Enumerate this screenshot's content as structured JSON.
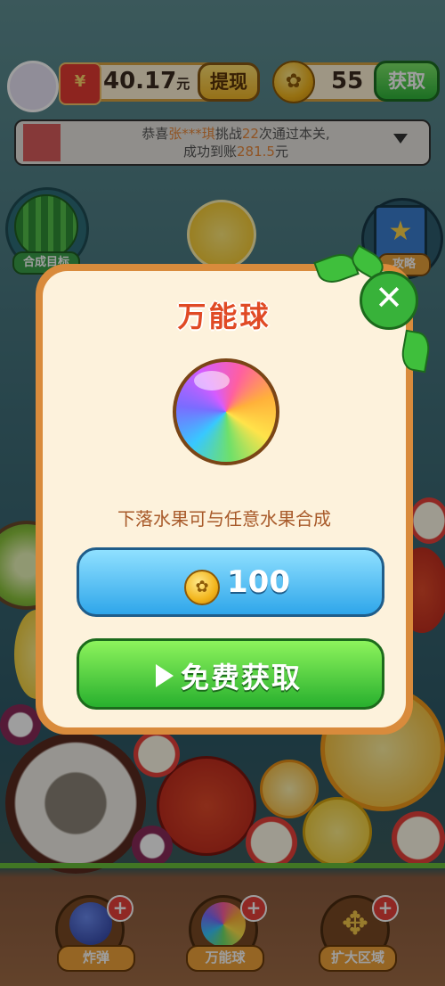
{
  "header": {
    "balance": "40.17",
    "balance_unit": "元",
    "redpack_symbol": "¥",
    "withdraw_label": "提现",
    "coins": "55",
    "get_label": "获取"
  },
  "notice": {
    "prefix": "恭喜",
    "name": "张***琪",
    "mid1": "挑战",
    "count": "22",
    "mid2": "次通过本关,",
    "line2_prefix": "成功到账",
    "amount": "281.5",
    "unit": "元"
  },
  "side": {
    "target_label": "合成目标",
    "guide_label": "攻略"
  },
  "modal": {
    "title": "万能球",
    "description": "下落水果可与任意水果合成",
    "price": "100",
    "free_label": "免费获取",
    "close_symbol": "✕"
  },
  "toolbar": {
    "items": [
      {
        "label": "炸弹",
        "icon": "bomb-icon"
      },
      {
        "label": "万能球",
        "icon": "rainbow-ball-icon"
      },
      {
        "label": "扩大区域",
        "icon": "expand-arrows-icon"
      }
    ],
    "plus_symbol": "+"
  },
  "colors": {
    "accent_orange": "#d98b3c",
    "title_red": "#e04a25",
    "button_blue": "#2fa6ea",
    "button_green": "#28b02e"
  }
}
